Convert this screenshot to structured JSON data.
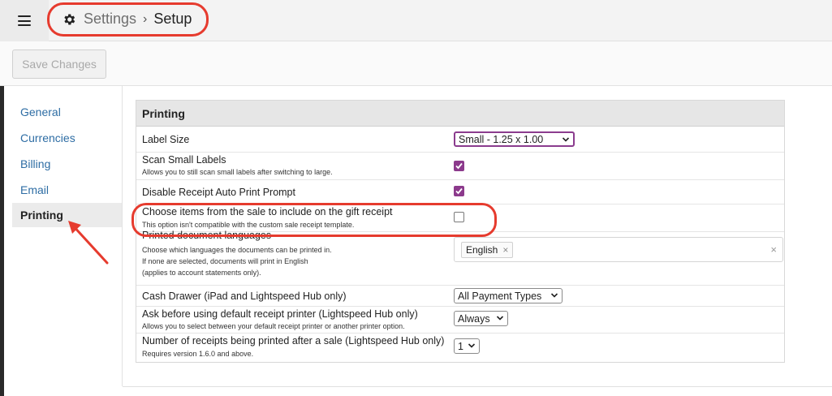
{
  "header": {
    "breadcrumb": [
      "Settings",
      "Setup"
    ],
    "separator": "›"
  },
  "toolbar": {
    "save_label": "Save Changes"
  },
  "sidebar": {
    "items": [
      {
        "label": "General",
        "active": false
      },
      {
        "label": "Currencies",
        "active": false
      },
      {
        "label": "Billing",
        "active": false
      },
      {
        "label": "Email",
        "active": false
      },
      {
        "label": "Printing",
        "active": true
      }
    ]
  },
  "panel": {
    "title": "Printing",
    "rows": {
      "label_size": {
        "label": "Label Size",
        "value": "Small - 1.25 x 1.00"
      },
      "scan_small": {
        "label": "Scan Small Labels",
        "sub": "Allows you to still scan small labels after switching to large.",
        "checked": true
      },
      "disable_auto_print": {
        "label": "Disable Receipt Auto Print Prompt",
        "checked": true
      },
      "gift_receipt": {
        "label": "Choose items from the sale to include on the gift receipt",
        "sub": "This option isn't compatible with the custom sale receipt template.",
        "checked": false
      },
      "doc_languages": {
        "label": "Printed document languages",
        "sub1": "Choose which languages the documents can be printed in.",
        "sub2": "If none are selected, documents will print in English",
        "sub3": "(applies to account statements only).",
        "tag": "English",
        "tag_remove": "×",
        "clear": "×"
      },
      "cash_drawer": {
        "label": "Cash Drawer (iPad and Lightspeed Hub only)",
        "value": "All Payment Types"
      },
      "ask_printer": {
        "label": "Ask before using default receipt printer (Lightspeed Hub only)",
        "sub": "Allows you to select between your default receipt printer or another printer option.",
        "value": "Always"
      },
      "num_receipts": {
        "label": "Number of receipts being printed after a sale (Lightspeed Hub only)",
        "sub": "Requires version 1.6.0 and above.",
        "value": "1"
      }
    }
  },
  "colors": {
    "accent": "#8c3a8c",
    "link": "#2e6da4",
    "annotation": "#e63b2e"
  }
}
